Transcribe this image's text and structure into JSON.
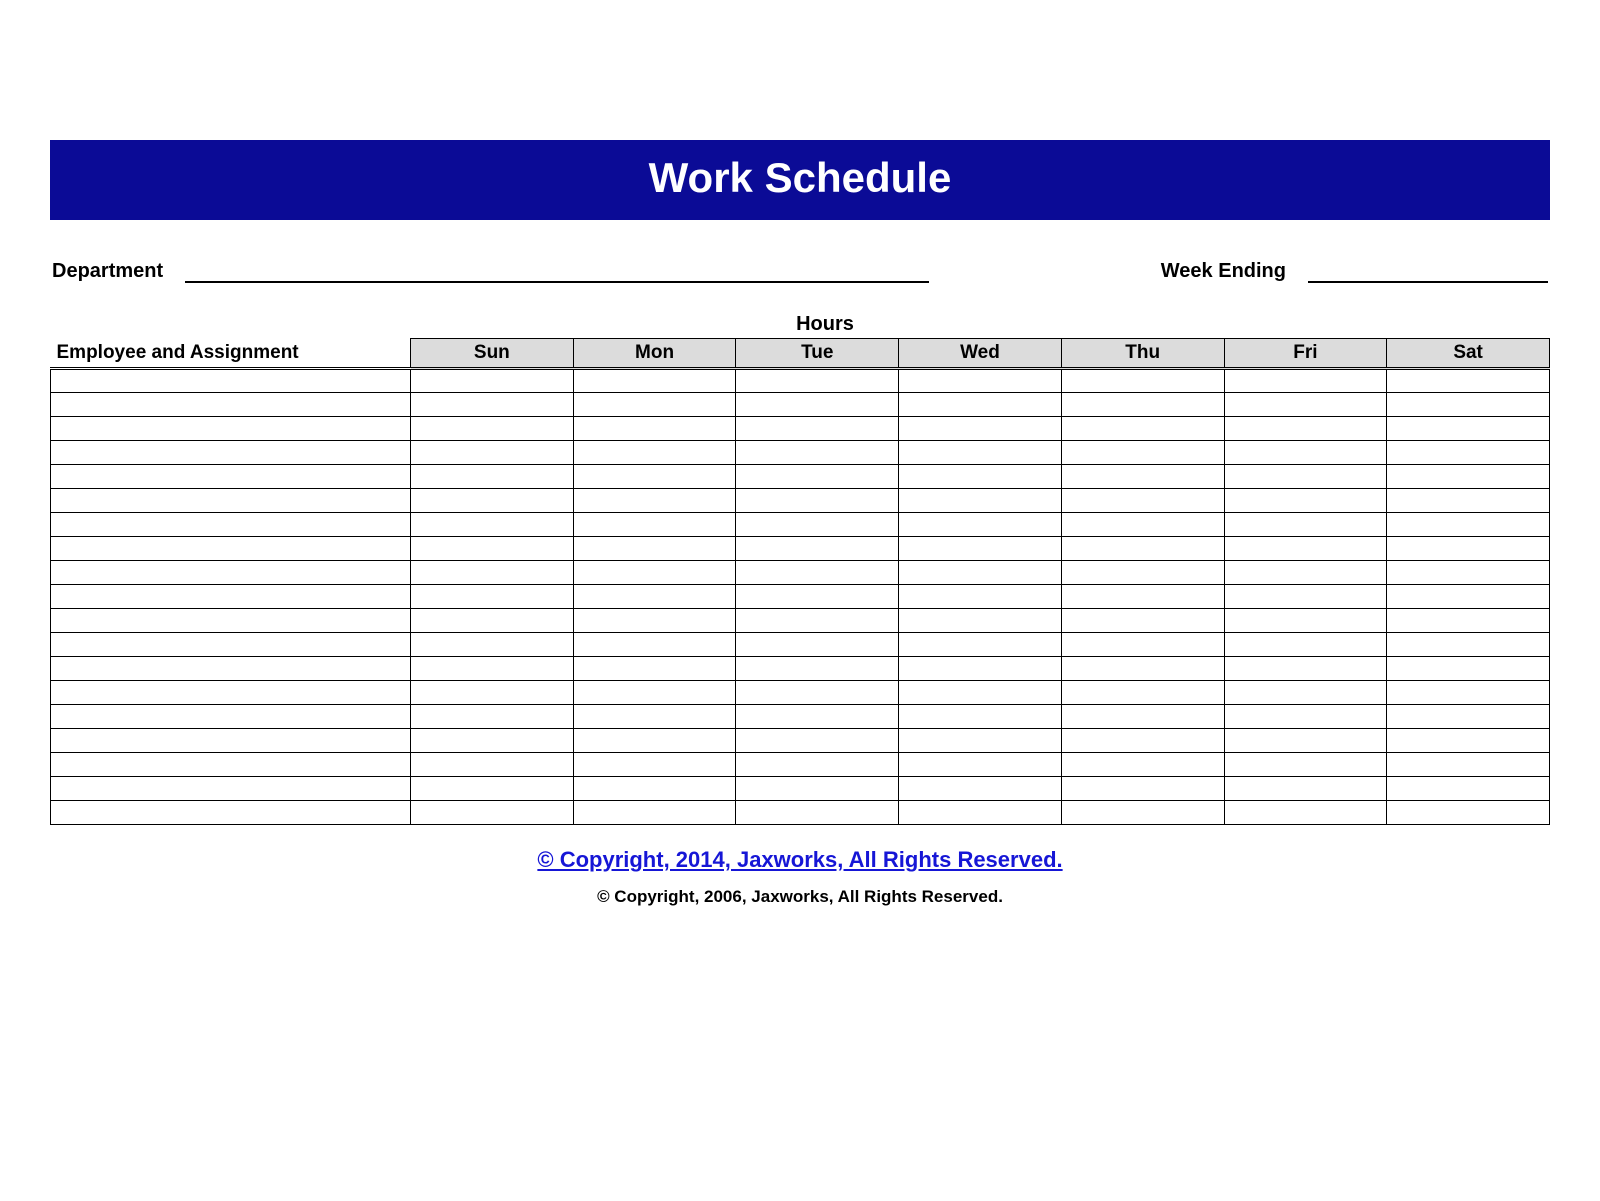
{
  "title": "Work Schedule",
  "meta": {
    "department_label": "Department",
    "week_ending_label": "Week Ending"
  },
  "table": {
    "hours_label": "Hours",
    "employee_header": "Employee and Assignment",
    "days": [
      "Sun",
      "Mon",
      "Tue",
      "Wed",
      "Thu",
      "Fri",
      "Sat"
    ],
    "row_count": 19
  },
  "footer": {
    "link_text": "© Copyright, 2014, Jaxworks, All Rights Reserved.",
    "sub_text": "© Copyright, 2006, Jaxworks, All Rights Reserved."
  }
}
